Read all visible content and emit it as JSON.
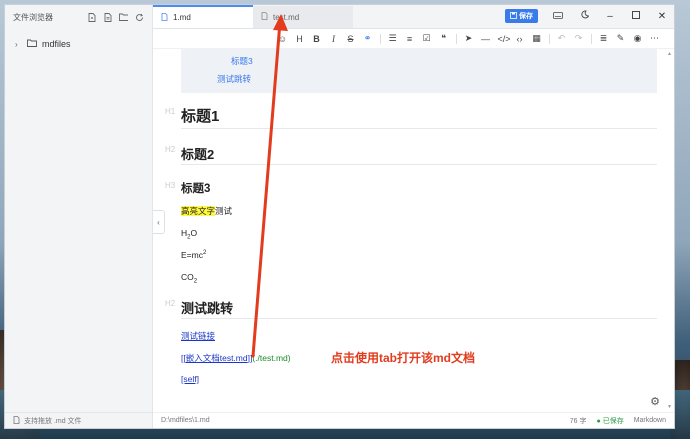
{
  "sidebar": {
    "title": "文件浏览器",
    "tree": [
      {
        "label": "mdfiles",
        "expanded": false
      }
    ],
    "footer": "支持拖放 .md 文件"
  },
  "tabs": [
    {
      "label": "1.md",
      "active": true
    },
    {
      "label": "test.md",
      "active": false
    }
  ],
  "header": {
    "save_label": "保存"
  },
  "toolbar": {
    "icons": [
      "emoji-icon",
      "heading-icon",
      "bold-icon",
      "italic-icon",
      "strikethrough-icon",
      "link-icon",
      "unordered-list-icon",
      "ordered-list-icon",
      "checklist-icon",
      "quote-icon",
      "send-icon",
      "horizontal-rule-icon",
      "code-icon",
      "inline-code-icon",
      "table-icon",
      "undo-icon",
      "redo-icon",
      "align-icon",
      "edit-icon",
      "preview-icon",
      "more-icon"
    ]
  },
  "toc": {
    "items": [
      "标题3",
      "测试跳转"
    ]
  },
  "doc": {
    "h1": "标题1",
    "h2": "标题2",
    "h3": "标题3",
    "highlight": "高亮文字",
    "highlight_suffix": "测试",
    "h2o": "H",
    "h2o_sub": "2",
    "h2o_end": "O",
    "emc": "E=mc",
    "emc_sup": "2",
    "co2": "CO",
    "co2_sub": "2",
    "h2b": "测试跳转",
    "link1": "测试链接",
    "wiki_open": "[[",
    "wiki_label": "嵌入文档test.md",
    "wiki_close": "]]",
    "wiki_path": "(./test.md)",
    "self_link": "[self]",
    "markers": [
      "H1",
      "H2",
      "H3",
      "H2"
    ]
  },
  "annotation": "点击使用tab打开该md文档",
  "status": {
    "path": "D:\\mdfiles\\1.md",
    "words": "76 字",
    "saved": "● 已保存",
    "mode": "Markdown"
  },
  "colors": {
    "accent": "#3a7bec",
    "annotation": "#e23b1e",
    "highlight": "#fff740"
  }
}
